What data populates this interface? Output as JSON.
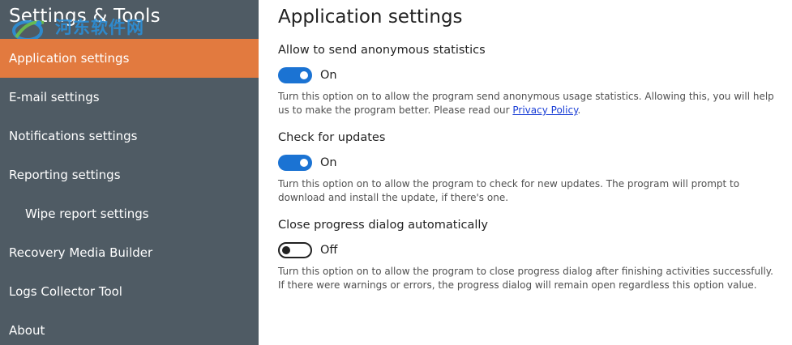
{
  "sidebar": {
    "title": "Settings & Tools",
    "items": [
      {
        "label": "Application settings",
        "active": true,
        "sub": false
      },
      {
        "label": "E-mail settings",
        "active": false,
        "sub": false
      },
      {
        "label": "Notifications settings",
        "active": false,
        "sub": false
      },
      {
        "label": "Reporting settings",
        "active": false,
        "sub": false
      },
      {
        "label": "Wipe report settings",
        "active": false,
        "sub": true
      },
      {
        "label": "Recovery Media Builder",
        "active": false,
        "sub": false
      },
      {
        "label": "Logs Collector Tool",
        "active": false,
        "sub": false
      },
      {
        "label": "About",
        "active": false,
        "sub": false
      }
    ]
  },
  "watermark": {
    "text": "河东软件网",
    "url": "www.pc0359.cn"
  },
  "main": {
    "title": "Application settings",
    "settings": [
      {
        "label": "Allow to send anonymous statistics",
        "state": "On",
        "enabled": true,
        "description": "Turn this option on to allow the program send anonymous usage statistics. Allowing this, you will help us to make the program better. Please read our ",
        "link_text": "Privacy Policy",
        "description_end": "."
      },
      {
        "label": "Check for updates",
        "state": "On",
        "enabled": true,
        "description": "Turn this option on to allow the program to check for new updates. The program will prompt to download and install the update, if there's one."
      },
      {
        "label": "Close progress dialog automatically",
        "state": "Off",
        "enabled": false,
        "description": "Turn this option on to allow the program to close progress dialog after finishing activities successfully. If there were warnings or errors, the progress dialog will remain open regardless this option value."
      }
    ]
  },
  "colors": {
    "sidebar_bg": "#4f5b64",
    "active_item": "#e27a3f",
    "toggle_on": "#1b73d3",
    "link": "#1b3fd6"
  }
}
